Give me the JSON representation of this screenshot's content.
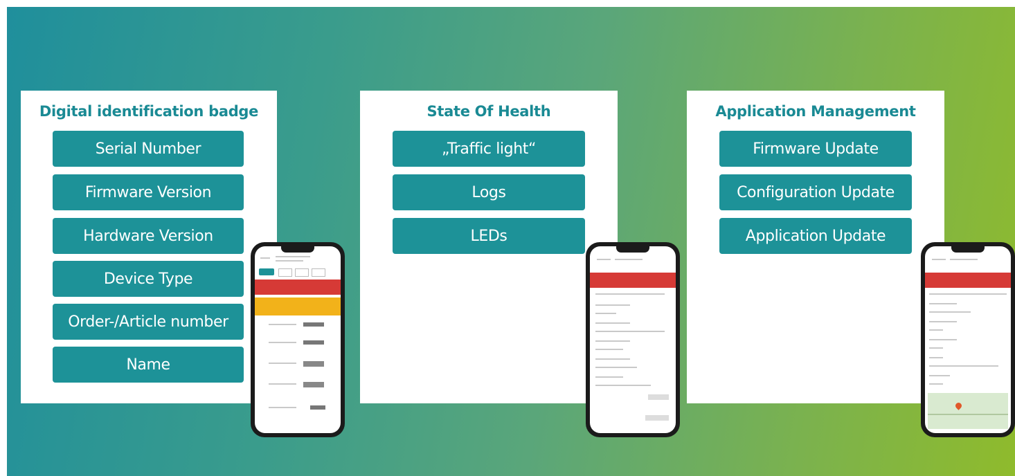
{
  "panels": [
    {
      "title": "Digital identification badge",
      "buttons": [
        "Serial Number",
        "Firmware Version",
        "Hardware Version",
        "Device Type",
        "Order-/Article number",
        "Name"
      ]
    },
    {
      "title": "State Of Health",
      "buttons": [
        "„Traffic light“",
        "Logs",
        "LEDs"
      ]
    },
    {
      "title": "Application Management",
      "buttons": [
        "Firmware Update",
        "Configuration Update",
        "Application Update"
      ]
    }
  ],
  "colors": {
    "button": "#1d9298",
    "title": "#1a8a94",
    "gradient_start": "#1f8f9c",
    "gradient_end": "#8fbb2c",
    "alert_red": "#d63a36",
    "warning_yellow": "#f2b21a"
  }
}
